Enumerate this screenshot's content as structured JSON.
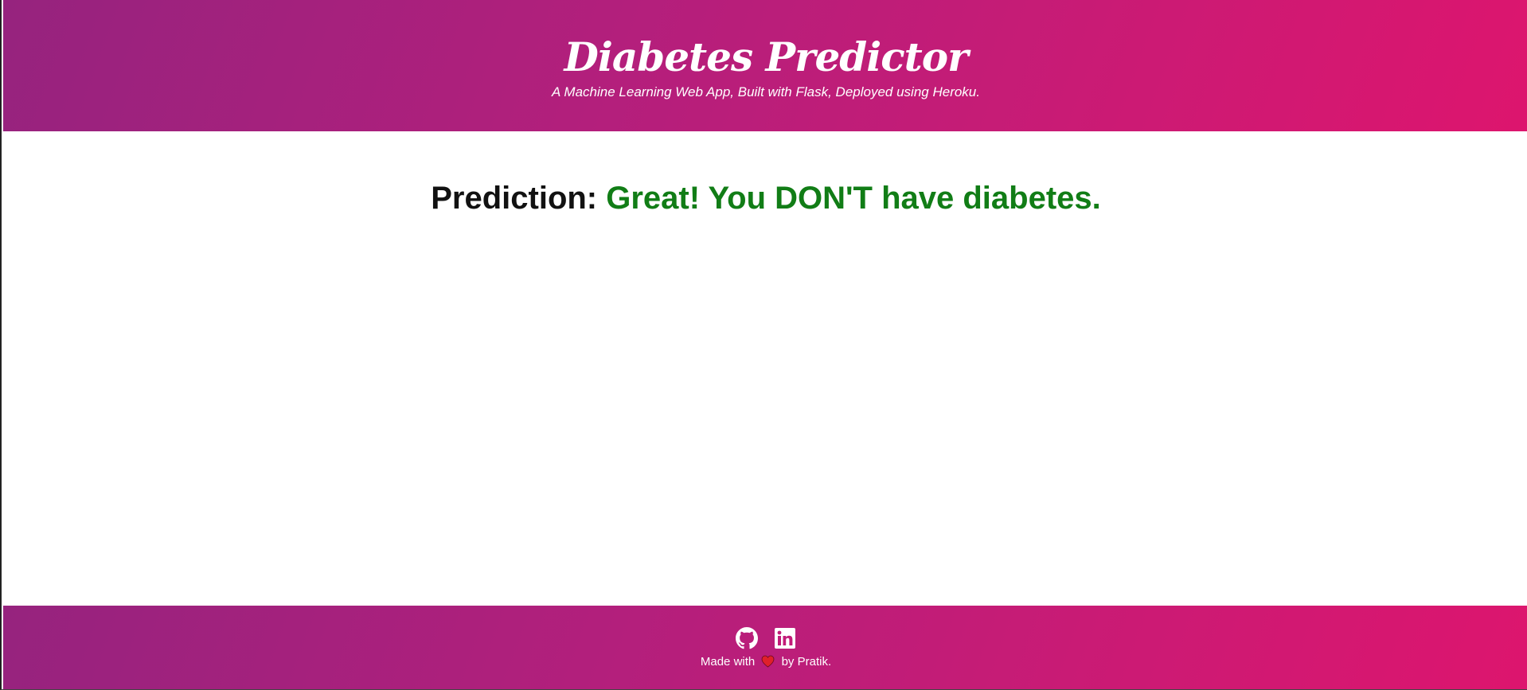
{
  "header": {
    "title": "Diabetes Predictor",
    "subtitle": "A Machine Learning Web App, Built with Flask, Deployed using Heroku."
  },
  "result": {
    "label": "Prediction: ",
    "text": "Great! You DON'T have diabetes.",
    "text_color": "#117d16"
  },
  "footer": {
    "social": [
      {
        "icon": "github-icon"
      },
      {
        "icon": "linkedin-icon"
      }
    ],
    "credit_prefix": "Made with",
    "credit_icon": "heart-icon",
    "credit_suffix": "by Pratik."
  },
  "colors": {
    "gradient_start": "#96237e",
    "gradient_end": "#dd156e",
    "heart": "#e0202a"
  }
}
